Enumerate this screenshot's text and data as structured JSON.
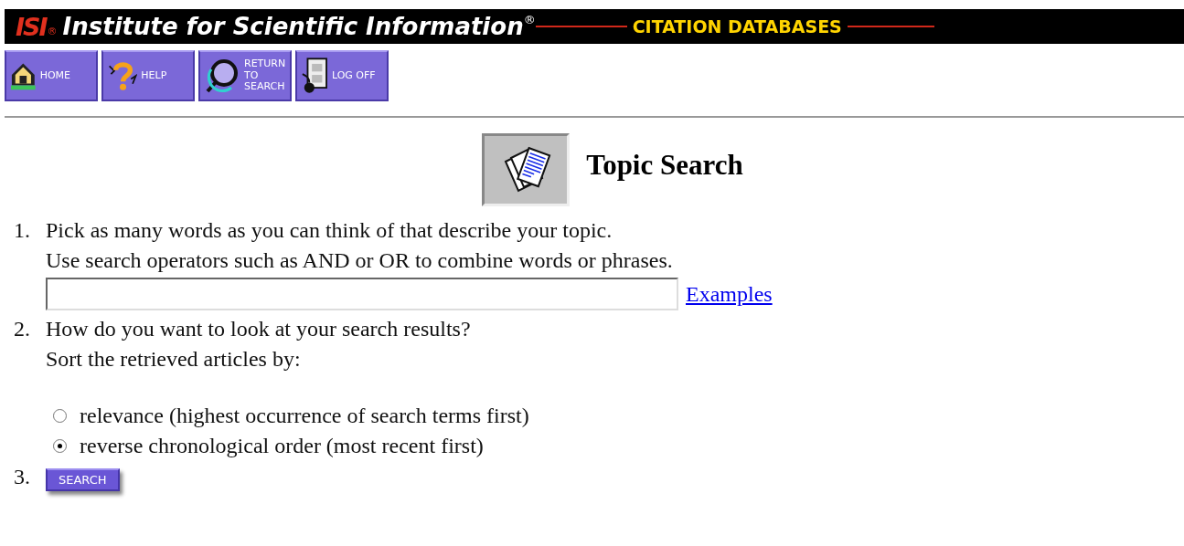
{
  "header": {
    "logo": "ISI",
    "logo_mark": "®",
    "title": "Institute for Scientific Information",
    "title_mark": "®",
    "subtitle": "CITATION DATABASES"
  },
  "toolbar": [
    {
      "kind": "home",
      "label": "HOME"
    },
    {
      "kind": "help",
      "label": "HELP"
    },
    {
      "kind": "return",
      "label": "RETURN TO SEARCH"
    },
    {
      "kind": "logoff",
      "label": "LOG OFF"
    }
  ],
  "page_title": "Topic Search",
  "steps": [
    {
      "number": "1.",
      "lines": [
        "Pick as many words as you can think of that describe your topic.",
        "Use search operators such as AND or OR to combine words or phrases."
      ],
      "field": {
        "kind": "text"
      },
      "link": "Examples"
    },
    {
      "number": "2.",
      "lines": [
        "How do you want to look at your search results?",
        "Sort the retrieved articles by:"
      ],
      "options": [
        {
          "label": "relevance (highest occurrence of search terms first)",
          "selected": false
        },
        {
          "label": "reverse chronological order (most recent first)",
          "selected": true
        }
      ]
    },
    {
      "number": "3.",
      "button": "SEARCH"
    }
  ]
}
